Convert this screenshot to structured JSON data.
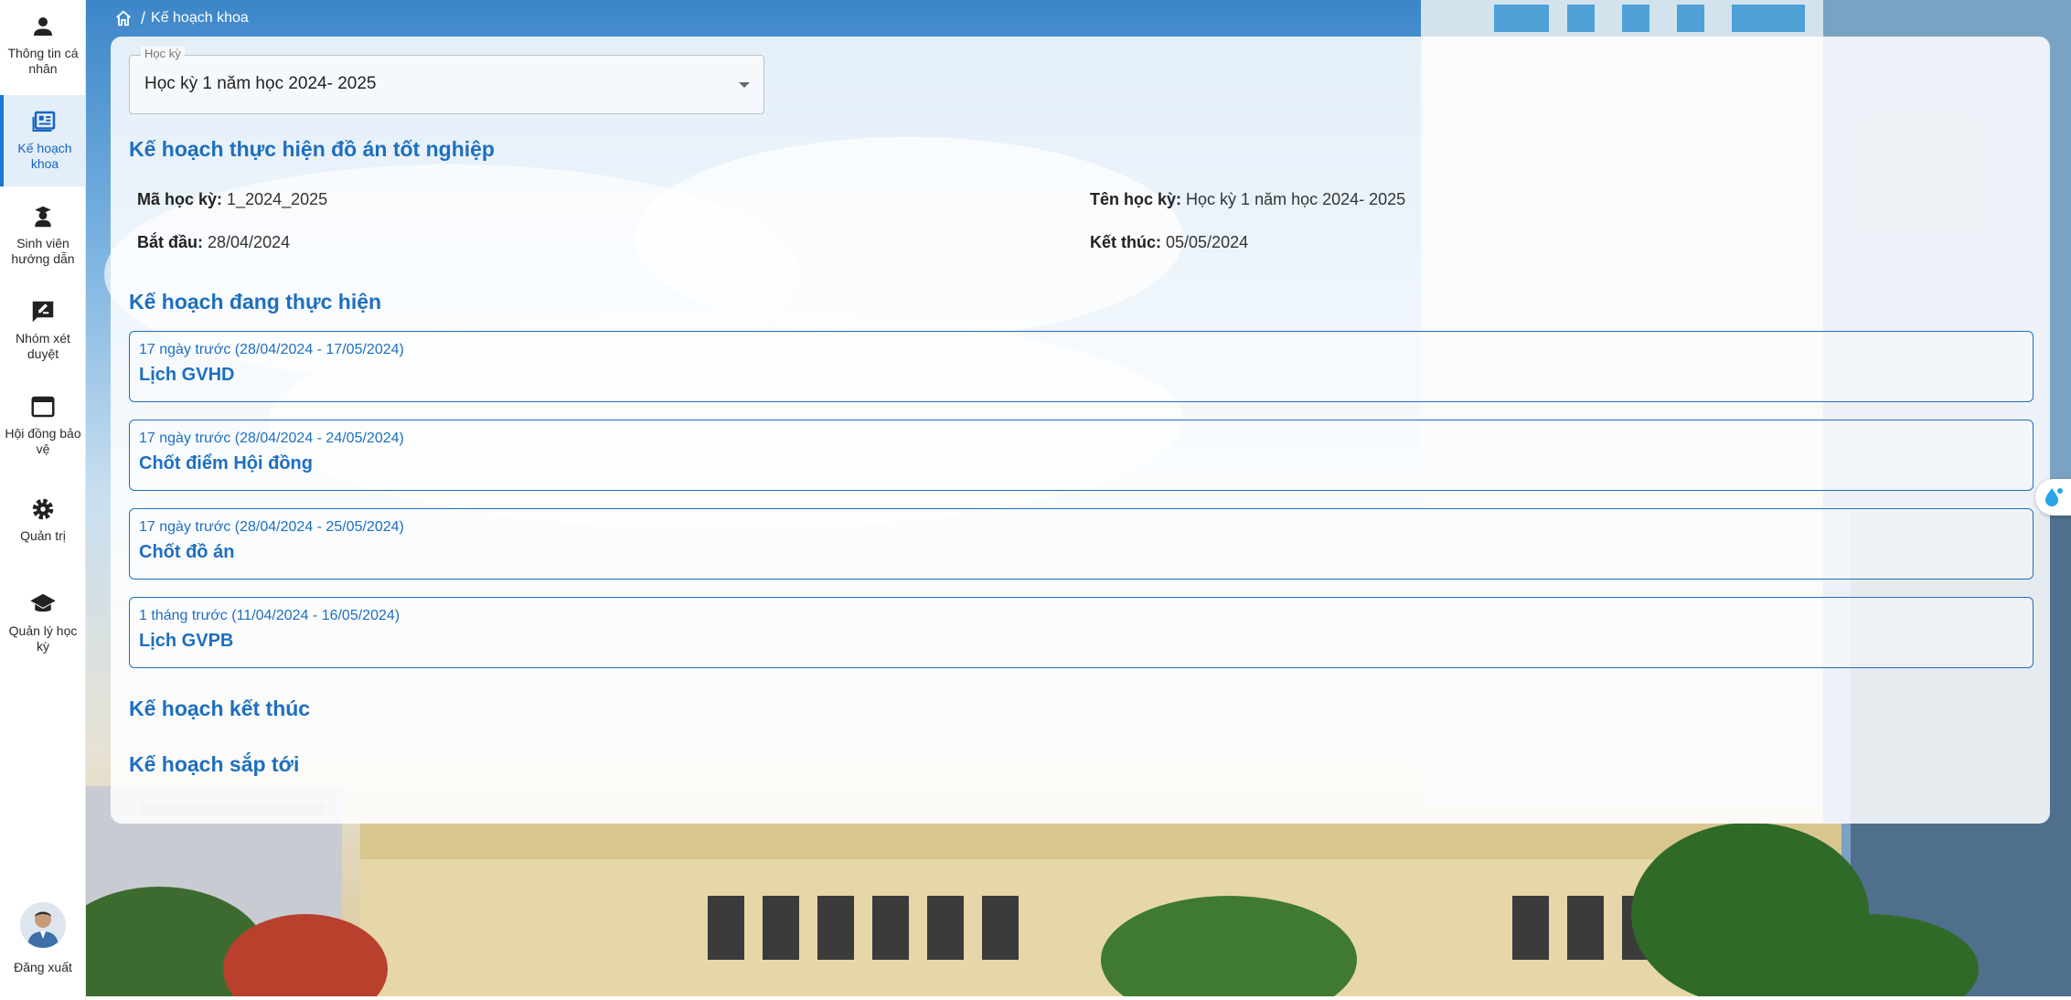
{
  "sidebar": {
    "items": [
      {
        "label": "Thông tin cá nhân",
        "icon": "person-icon",
        "active": false
      },
      {
        "label": "Kế hoạch khoa",
        "icon": "newspaper-icon",
        "active": true
      },
      {
        "label": "Sinh viên hướng dẫn",
        "icon": "graduate-icon",
        "active": false
      },
      {
        "label": "Nhóm xét duyệt",
        "icon": "rate-review-icon",
        "active": false
      },
      {
        "label": "Hội đồng bảo vệ",
        "icon": "window-icon",
        "active": false
      },
      {
        "label": "Quản trị",
        "icon": "gear-icon",
        "active": false
      },
      {
        "label": "Quản lý học kỳ",
        "icon": "school-cap-icon",
        "active": false
      }
    ],
    "logout_label": "Đăng xuất"
  },
  "breadcrumb": {
    "separator": "/",
    "current": "Kế hoạch khoa"
  },
  "semester_select": {
    "label": "Học kỳ",
    "value": "Học kỳ 1 năm học 2024- 2025"
  },
  "thesis_plan": {
    "title": "Kế hoạch thực hiện đồ án tốt nghiệp",
    "code_label": "Mã học kỳ:",
    "code_value": "1_2024_2025",
    "name_label": "Tên học kỳ:",
    "name_value": "Học kỳ 1 năm học 2024- 2025",
    "start_label": "Bắt đầu:",
    "start_value": "28/04/2024",
    "end_label": "Kết thúc:",
    "end_value": "05/05/2024"
  },
  "ongoing": {
    "title": "Kế hoạch đang thực hiện",
    "plans": [
      {
        "time": "17 ngày trước (28/04/2024 - 17/05/2024)",
        "name": "Lịch GVHD"
      },
      {
        "time": "17 ngày trước (28/04/2024 - 24/05/2024)",
        "name": "Chốt điểm Hội đồng"
      },
      {
        "time": "17 ngày trước (28/04/2024 - 25/05/2024)",
        "name": "Chốt đồ án"
      },
      {
        "time": "1 tháng trước (11/04/2024 - 16/05/2024)",
        "name": "Lịch GVPB"
      }
    ]
  },
  "finished": {
    "title": "Kế hoạch kết thúc"
  },
  "upcoming": {
    "title": "Kế hoạch sắp tới"
  },
  "colors": {
    "accent": "#1e6fbf",
    "sidebar_active_bg": "#e3eef9",
    "text": "#333333"
  }
}
